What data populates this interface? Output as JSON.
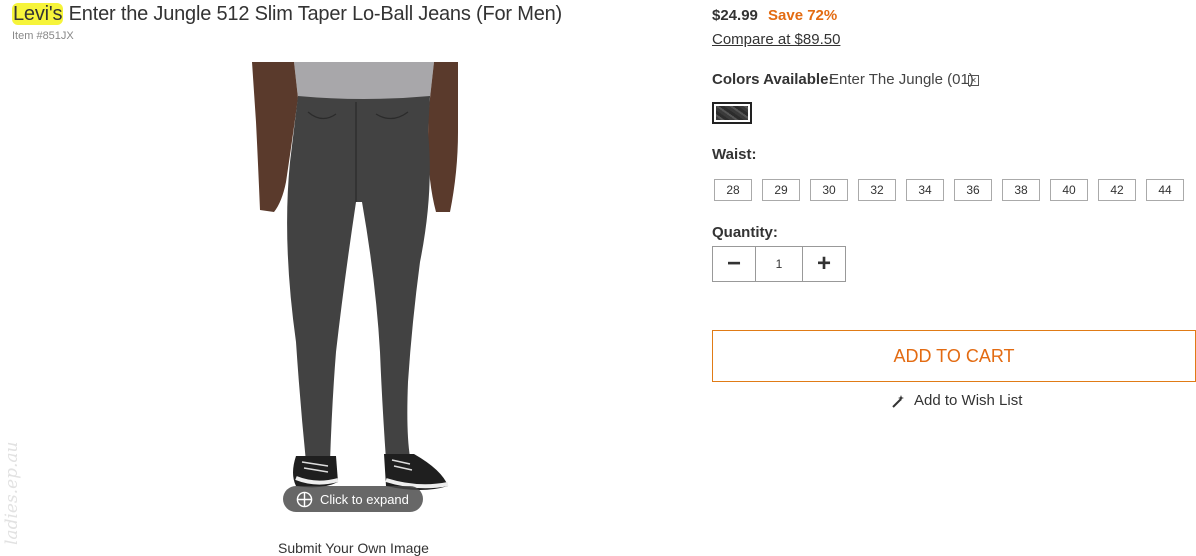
{
  "product": {
    "brand": "Levi's",
    "name": "Enter the Jungle 512 Slim Taper Lo-Ball Jeans (For Men)",
    "item_number": "Item #851JX"
  },
  "image": {
    "expand_label": "Click to expand",
    "submit_label": "Submit Your Own Image",
    "watermark": "ladies.ep.au"
  },
  "pricing": {
    "price": "$24.99",
    "save": "Save 72%",
    "compare": "Compare at $89.50"
  },
  "colors": {
    "label": "Colors Available:",
    "selected": "Enter The Jungle (01)"
  },
  "waist": {
    "label": "Waist:",
    "sizes": [
      "28",
      "29",
      "30",
      "32",
      "34",
      "36",
      "38",
      "40",
      "42",
      "44"
    ]
  },
  "quantity": {
    "label": "Quantity:",
    "value": "1",
    "minus": "−",
    "plus": "+"
  },
  "actions": {
    "add_to_cart": "ADD TO CART",
    "wish_list": "Add to Wish List"
  },
  "colors_theme": {
    "accent": "#e36b12",
    "highlight": "#f6f43a"
  }
}
